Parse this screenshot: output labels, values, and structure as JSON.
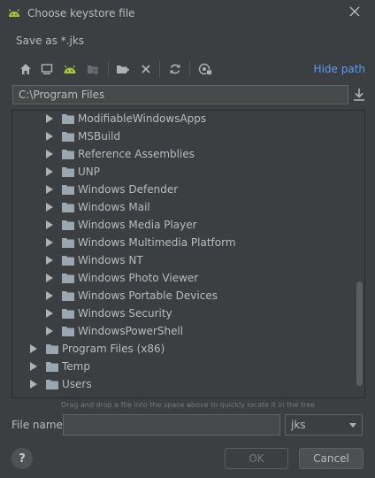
{
  "window": {
    "title": "Choose keystore file"
  },
  "dialog": {
    "subtitle": "Save as *.jks"
  },
  "toolbar": {
    "hide_path_label": "Hide path"
  },
  "path": {
    "value": "C:\\Program Files"
  },
  "tree": {
    "items": [
      {
        "label": "ModifiableWindowsApps"
      },
      {
        "label": "MSBuild"
      },
      {
        "label": "Reference Assemblies"
      },
      {
        "label": "UNP"
      },
      {
        "label": "Windows Defender"
      },
      {
        "label": "Windows Mail"
      },
      {
        "label": "Windows Media Player"
      },
      {
        "label": "Windows Multimedia Platform"
      },
      {
        "label": "Windows NT"
      },
      {
        "label": "Windows Photo Viewer"
      },
      {
        "label": "Windows Portable Devices"
      },
      {
        "label": "Windows Security"
      },
      {
        "label": "WindowsPowerShell"
      },
      {
        "label": "Program Files (x86)"
      },
      {
        "label": "Temp"
      },
      {
        "label": "Users"
      }
    ]
  },
  "hint": "Drag and drop a file into the space above to quickly locate it in the tree",
  "filename": {
    "label": "File name:",
    "value": ""
  },
  "extension": {
    "selected": "jks"
  },
  "buttons": {
    "help": "?",
    "ok": "OK",
    "cancel": "Cancel"
  },
  "colors": {
    "background": "#3c3f41",
    "link": "#589df6",
    "android": "#a4c639",
    "folder": "#9aa7b0"
  }
}
